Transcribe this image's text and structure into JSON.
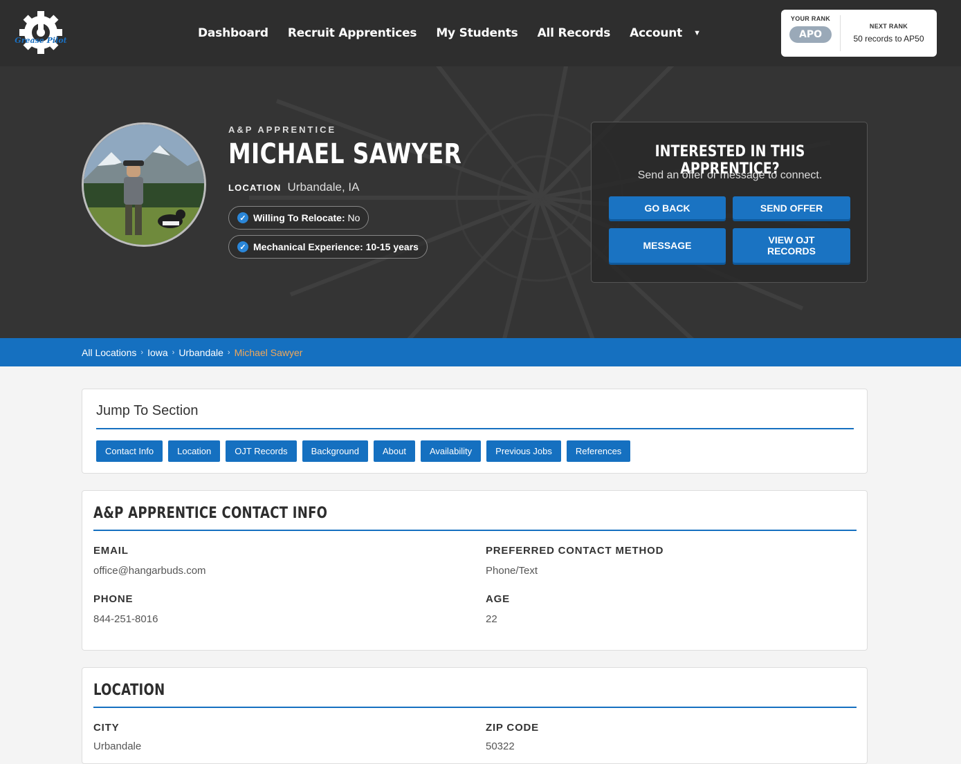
{
  "nav": {
    "logo_text": "Grease Pilot",
    "links": [
      "Dashboard",
      "Recruit Apprentices",
      "My Students",
      "All Records",
      "Account"
    ],
    "rank": {
      "your_rank_label": "YOUR RANK",
      "your_rank_value": "APO",
      "next_rank_label": "NEXT RANK",
      "next_rank_value": "50 records to AP50"
    }
  },
  "profile": {
    "eyebrow": "A&P APPRENTICE",
    "name": "MICHAEL SAWYER",
    "location_label": "LOCATION",
    "location_value": "Urbandale, IA",
    "chips": [
      {
        "label": "Willing To Relocate:",
        "value": "No"
      },
      {
        "label": "Mechanical Experience:",
        "value": "10-15 years"
      }
    ]
  },
  "offer": {
    "title": "INTERESTED IN THIS APPRENTICE?",
    "subtitle": "Send an offer or message to connect.",
    "buttons": {
      "go_back": "GO BACK",
      "send_offer": "SEND OFFER",
      "message": "MESSAGE",
      "view_ojt_line1": "VIEW OJT",
      "view_ojt_line2": "RECORDS"
    }
  },
  "breadcrumb": {
    "items": [
      "All Locations",
      "Iowa",
      "Urbandale"
    ],
    "current": "Michael Sawyer",
    "separator": "›"
  },
  "jump": {
    "title": "Jump To Section",
    "buttons": [
      "Contact Info",
      "Location",
      "OJT Records",
      "Background",
      "About",
      "Availability",
      "Previous Jobs",
      "References"
    ]
  },
  "contact": {
    "title": "A&P APPRENTICE CONTACT INFO",
    "email_label": "EMAIL",
    "email_value": "office@hangarbuds.com",
    "method_label": "PREFERRED CONTACT METHOD",
    "method_value": "Phone/Text",
    "phone_label": "PHONE",
    "phone_value": "844-251-8016",
    "age_label": "AGE",
    "age_value": "22"
  },
  "location": {
    "title": "LOCATION",
    "city_label": "CITY",
    "city_value": "Urbandale",
    "zip_label": "ZIP CODE",
    "zip_value": "50322"
  },
  "colors": {
    "nav_bg": "#2e2e2e",
    "accent_blue": "#1570c0",
    "breadcrumb_current": "#f0a85a"
  }
}
